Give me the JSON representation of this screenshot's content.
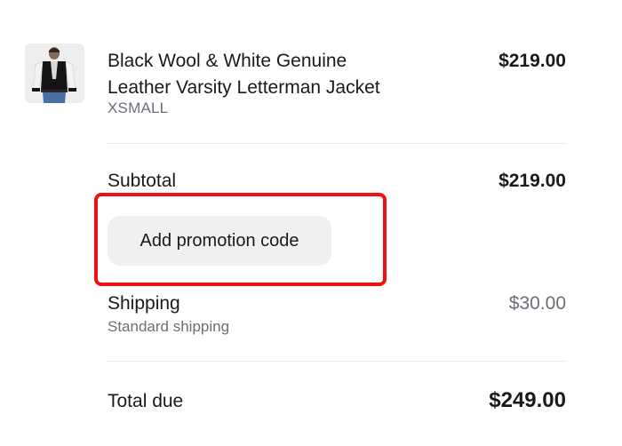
{
  "colors": {
    "highlight": "#ee1111",
    "muted_text": "#6d6e78",
    "button_bg": "#f0f0f0"
  },
  "line_item": {
    "thumbnail_icon": "jacket-thumbnail-image",
    "name_line1": "Black Wool & White Genuine",
    "name_line2": "Leather Varsity Letterman Jacket",
    "variant": "XSMALL",
    "price": "$219.00"
  },
  "subtotal": {
    "label": "Subtotal",
    "value": "$219.00"
  },
  "promotion": {
    "button_label": "Add promotion code"
  },
  "shipping": {
    "label": "Shipping",
    "method": "Standard shipping",
    "value": "$30.00"
  },
  "total": {
    "label": "Total due",
    "value": "$249.00"
  }
}
